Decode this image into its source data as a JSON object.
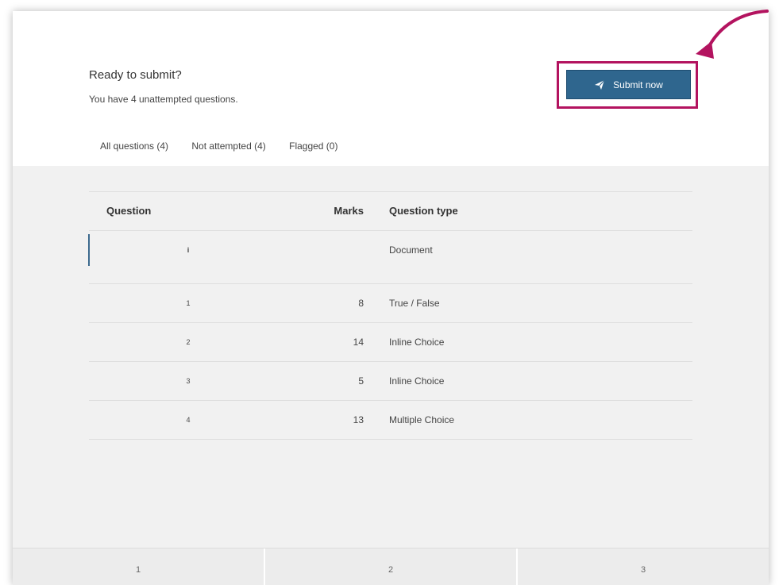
{
  "header": {
    "title": "Ready to submit?",
    "subtitle": "You have 4 unattempted questions.",
    "submit_label": "Submit now"
  },
  "tabs": [
    {
      "label": "All questions (4)"
    },
    {
      "label": "Not attempted (4)"
    },
    {
      "label": "Flagged (0)"
    }
  ],
  "table": {
    "columns": {
      "question": "Question",
      "marks": "Marks",
      "type": "Question type"
    },
    "document_row": {
      "question": "i",
      "marks": "",
      "type": "Document"
    },
    "rows": [
      {
        "question": "1",
        "marks": "8",
        "type": "True / False"
      },
      {
        "question": "2",
        "marks": "14",
        "type": "Inline Choice"
      },
      {
        "question": "3",
        "marks": "5",
        "type": "Inline Choice"
      },
      {
        "question": "4",
        "marks": "13",
        "type": "Multiple Choice"
      }
    ]
  },
  "pagination": [
    {
      "label": "1"
    },
    {
      "label": "2"
    },
    {
      "label": "3"
    }
  ],
  "colors": {
    "button": "#2f668e",
    "highlight": "#b3135f",
    "accent_bar": "#3d6a8e"
  },
  "icons": {
    "submit": "paper-plane-icon",
    "callout": "curved-arrow-icon"
  }
}
